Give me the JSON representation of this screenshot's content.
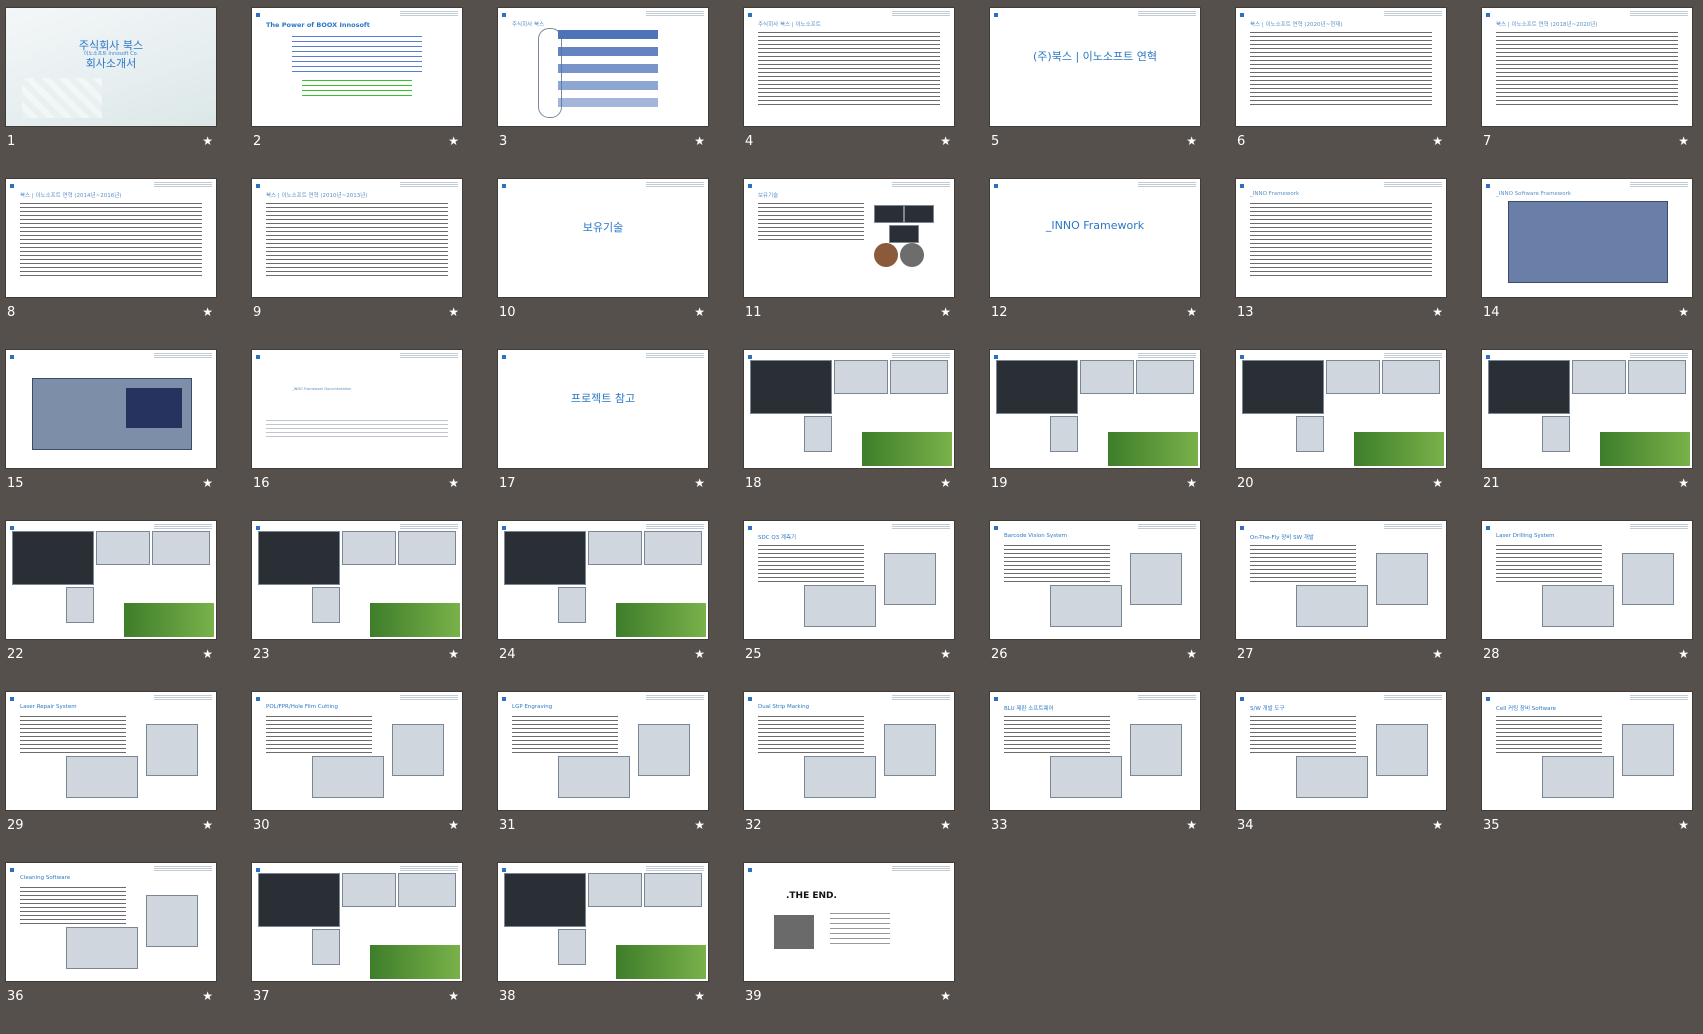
{
  "slides": [
    {
      "n": "1",
      "kind": "cover",
      "title": "주식회사 북스",
      "subtitle": "이노소프트 Innosoft Co.",
      "title2": "회사소개서"
    },
    {
      "n": "2",
      "kind": "power",
      "title": "The Power of BOOX Innosoft"
    },
    {
      "n": "3",
      "kind": "toc",
      "title": "주식회사 북스"
    },
    {
      "n": "4",
      "kind": "text",
      "title": "주식회사 북스 | 이노소프트"
    },
    {
      "n": "5",
      "kind": "section",
      "title": "(주)북스 | 이노소프트 연혁"
    },
    {
      "n": "6",
      "kind": "text",
      "title": "북스 | 이노소프트 연혁 (2020년~현재)"
    },
    {
      "n": "7",
      "kind": "text",
      "title": "북스 | 이노소프트 연혁 (2018년~2020년)"
    },
    {
      "n": "8",
      "kind": "text",
      "title": "북스 | 이노소프트 연혁 (2014년~2016년)"
    },
    {
      "n": "9",
      "kind": "text",
      "title": "북스 | 이노소프트 연혁 (2010년~2013년)"
    },
    {
      "n": "10",
      "kind": "section",
      "title": "보유기술"
    },
    {
      "n": "11",
      "kind": "tech",
      "title": "보유기술"
    },
    {
      "n": "12",
      "kind": "section",
      "title": "_INNO Framework"
    },
    {
      "n": "13",
      "kind": "text",
      "title": "_INNO Framework"
    },
    {
      "n": "14",
      "kind": "diagram",
      "title": "_INNO Software Framework"
    },
    {
      "n": "15",
      "kind": "diagram2",
      "title": ""
    },
    {
      "n": "16",
      "kind": "blank",
      "title": "_INNO Framework Documentation"
    },
    {
      "n": "17",
      "kind": "section",
      "title": "프로젝트 참고"
    },
    {
      "n": "18",
      "kind": "shots",
      "title": ""
    },
    {
      "n": "19",
      "kind": "shots",
      "title": ""
    },
    {
      "n": "20",
      "kind": "shots",
      "title": ""
    },
    {
      "n": "21",
      "kind": "shots",
      "title": ""
    },
    {
      "n": "22",
      "kind": "shots",
      "title": ""
    },
    {
      "n": "23",
      "kind": "shots",
      "title": ""
    },
    {
      "n": "24",
      "kind": "shots",
      "title": ""
    },
    {
      "n": "25",
      "kind": "project",
      "title": "SDC Q3 계측기"
    },
    {
      "n": "26",
      "kind": "project",
      "title": "Barcode Vision System"
    },
    {
      "n": "27",
      "kind": "project",
      "title": "On-The-Fly 장비 SW 개발"
    },
    {
      "n": "28",
      "kind": "project",
      "title": "Laser Drilling System"
    },
    {
      "n": "29",
      "kind": "project",
      "title": "Laser Repair System"
    },
    {
      "n": "30",
      "kind": "project",
      "title": "POL/FPR/Hole Film Cutting"
    },
    {
      "n": "31",
      "kind": "project",
      "title": "LGP Engraving"
    },
    {
      "n": "32",
      "kind": "project",
      "title": "Dual Strip Marking"
    },
    {
      "n": "33",
      "kind": "project",
      "title": "BLU 제판 소프트웨어"
    },
    {
      "n": "34",
      "kind": "project",
      "title": "S/W 개발 도구"
    },
    {
      "n": "35",
      "kind": "project",
      "title": "Cell 커팅 장비 Software"
    },
    {
      "n": "36",
      "kind": "project",
      "title": "Cleaning Software"
    },
    {
      "n": "37",
      "kind": "shots",
      "title": ""
    },
    {
      "n": "38",
      "kind": "shots",
      "title": ""
    },
    {
      "n": "39",
      "kind": "end",
      "title": ".THE END."
    }
  ],
  "star_icon": "★"
}
